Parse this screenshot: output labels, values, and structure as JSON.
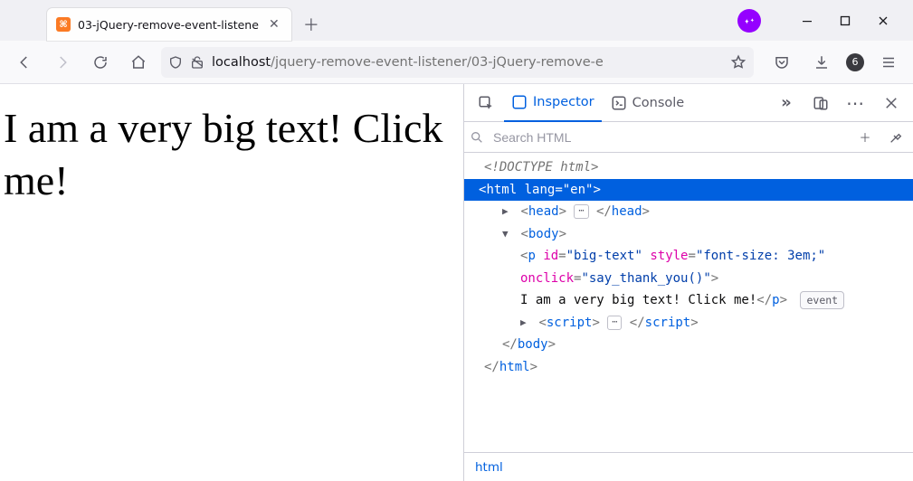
{
  "tab": {
    "title": "03-jQuery-remove-event-listene",
    "favicon_letter": "⧉"
  },
  "url": {
    "host": "localhost",
    "path": "/jquery-remove-event-listener/03-jQuery-remove-e"
  },
  "toolbar_badge": "6",
  "page": {
    "big_text": "I am a very big text! Click me!"
  },
  "devtools": {
    "tabs": {
      "inspector": "Inspector",
      "console": "Console"
    },
    "search_placeholder": "Search HTML",
    "ellipsis": "⋯",
    "event_label": "event",
    "dom": {
      "doctype": "<!DOCTYPE html>",
      "html_open": {
        "tag": "html",
        "attr": "lang",
        "val": "\"en\""
      },
      "head_open": "head",
      "head_close": "head",
      "body_open": "body",
      "p": {
        "tag": "p",
        "id_attr": "id",
        "id_val": "\"big-text\"",
        "style_attr": "style",
        "style_val": "\"font-size: 3em;\"",
        "onclick_attr": "onclick",
        "onclick_val": "\"say_thank_you()\"",
        "text": "I am a very big text! Click me!"
      },
      "script_tag": "script",
      "body_close": "body",
      "html_close": "html"
    },
    "crumb": "html"
  }
}
